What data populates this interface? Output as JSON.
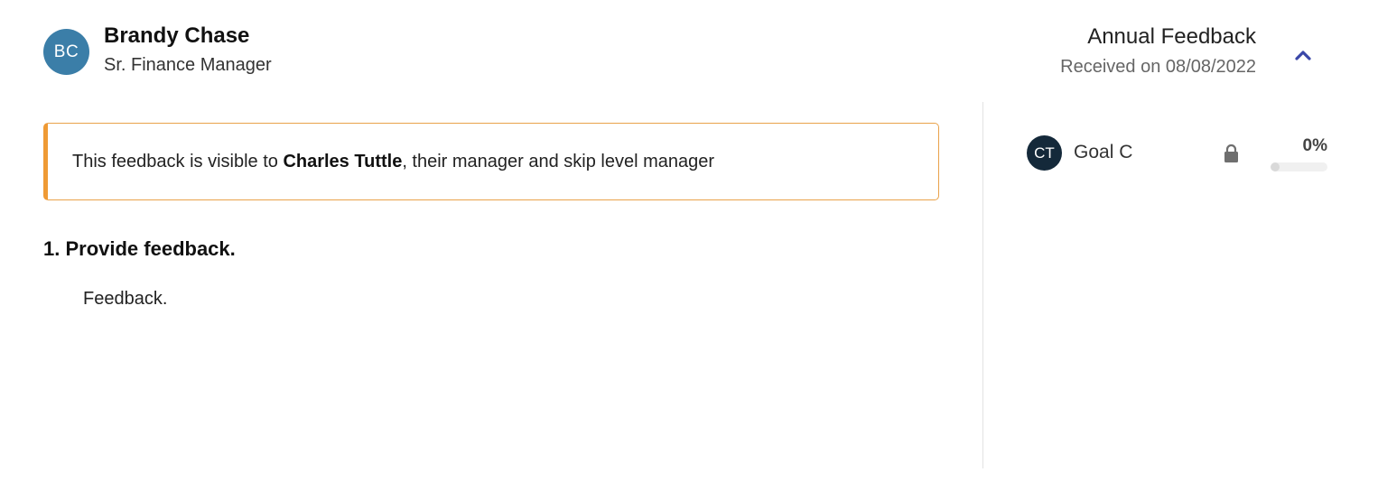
{
  "header": {
    "avatar_initials": "BC",
    "name": "Brandy Chase",
    "role": "Sr. Finance Manager",
    "feedback_type": "Annual Feedback",
    "received": "Received on 08/08/2022",
    "collapse_icon": "chevron-up-icon"
  },
  "notice": {
    "prefix": "This feedback is visible to ",
    "person": "Charles Tuttle",
    "suffix": ", their manager and skip level manager"
  },
  "questions": [
    {
      "title": "1. Provide feedback.",
      "answer": "Feedback."
    }
  ],
  "goal": {
    "avatar_initials": "CT",
    "name": "Goal C",
    "lock_icon": "lock-icon",
    "progress_label": "0%",
    "progress_percent": 0
  },
  "colors": {
    "avatar_primary": "#3b7ea8",
    "avatar_goal": "#14293a",
    "notice_accent": "#ef9a35",
    "chevron": "#3a47a8"
  }
}
